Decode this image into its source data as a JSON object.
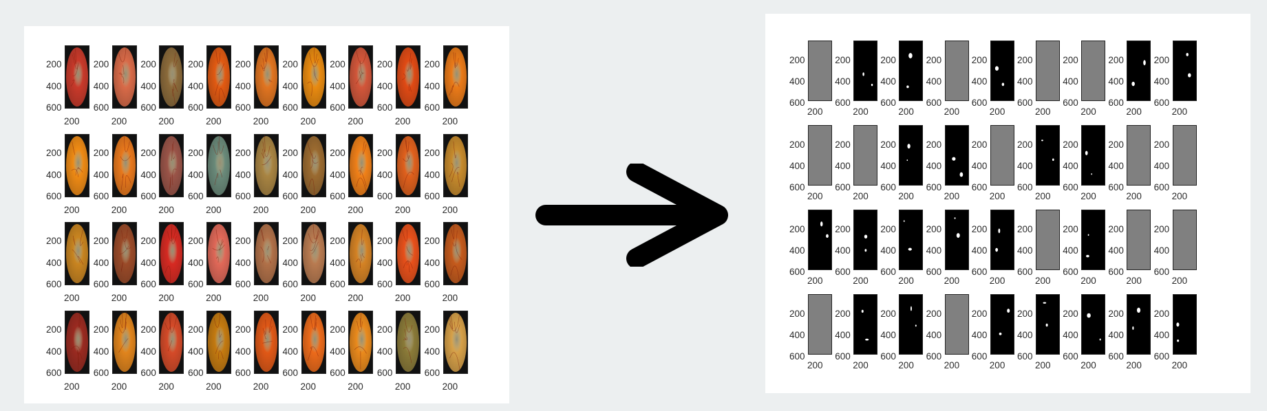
{
  "colors": {
    "background": "#eceff0",
    "panel": "#ffffff",
    "arrow": "#000000",
    "empty_mask": "#808080",
    "mask_background": "#000000",
    "mask_lesion": "#ffffff"
  },
  "axis_ticks": {
    "y": [
      "200",
      "400",
      "600"
    ],
    "x": [
      "200"
    ]
  },
  "left_panel": {
    "rows": [
      [
        {
          "hue": "#c8392a"
        },
        {
          "hue": "#d86a48"
        },
        {
          "hue": "#8b6a3a"
        },
        {
          "hue": "#e25a12"
        },
        {
          "hue": "#e07420"
        },
        {
          "hue": "#e88a10"
        },
        {
          "hue": "#d2563a"
        },
        {
          "hue": "#e04a14"
        },
        {
          "hue": "#ea7a18"
        }
      ],
      [
        {
          "hue": "#ee8a14"
        },
        {
          "hue": "#e8781c"
        },
        {
          "hue": "#9a5448"
        },
        {
          "hue": "#6a8a7a"
        },
        {
          "hue": "#a88442"
        },
        {
          "hue": "#9a6a30"
        },
        {
          "hue": "#f08018"
        },
        {
          "hue": "#e0601c"
        },
        {
          "hue": "#c68a2c"
        }
      ],
      [
        {
          "hue": "#c88420"
        },
        {
          "hue": "#9a4a28"
        },
        {
          "hue": "#d62a22"
        },
        {
          "hue": "#e06858"
        },
        {
          "hue": "#b07048"
        },
        {
          "hue": "#b87a50"
        },
        {
          "hue": "#d48224"
        },
        {
          "hue": "#e8501a"
        },
        {
          "hue": "#c45a1c"
        }
      ],
      [
        {
          "hue": "#9a2a20"
        },
        {
          "hue": "#e0841c"
        },
        {
          "hue": "#d44a28"
        },
        {
          "hue": "#c47a10"
        },
        {
          "hue": "#e05816"
        },
        {
          "hue": "#ec6a1a"
        },
        {
          "hue": "#ea8a1c"
        },
        {
          "hue": "#8a7a38"
        },
        {
          "hue": "#d6a048"
        }
      ]
    ]
  },
  "right_panel": {
    "rows": [
      [
        "empty",
        "lesion",
        "lesion",
        "empty",
        "lesion",
        "empty",
        "empty",
        "lesion",
        "lesion"
      ],
      [
        "empty",
        "empty",
        "lesion",
        "lesion",
        "empty",
        "lesion",
        "lesion",
        "empty",
        "empty"
      ],
      [
        "lesion",
        "lesion",
        "lesion",
        "lesion",
        "lesion",
        "empty",
        "lesion",
        "empty",
        "empty"
      ],
      [
        "empty",
        "lesion",
        "lesion",
        "empty",
        "lesion",
        "lesion",
        "lesion",
        "lesion",
        "lesion"
      ]
    ]
  }
}
